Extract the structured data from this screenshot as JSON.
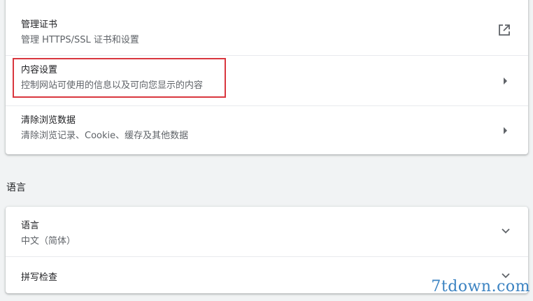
{
  "privacy_section": {
    "items": [
      {
        "title": "管理证书",
        "subtitle": "管理 HTTPS/SSL 证书和设置",
        "icon": "external-link-icon"
      },
      {
        "title": "内容设置",
        "subtitle": "控制网站可使用的信息以及可向您显示的内容",
        "icon": "chevron-right-icon"
      },
      {
        "title": "清除浏览数据",
        "subtitle": "清除浏览记录、Cookie、缓存及其他数据",
        "icon": "chevron-right-icon"
      }
    ]
  },
  "language_section": {
    "heading": "语言",
    "items": [
      {
        "title": "语言",
        "subtitle": "中文（简体）",
        "icon": "chevron-down-icon"
      },
      {
        "title": "拼写检查",
        "icon": "chevron-down-icon"
      }
    ]
  },
  "watermark": "7tdown.com",
  "colors": {
    "highlight": "#d9363e",
    "watermark": "#3b83c2",
    "icon": "#5f6368"
  }
}
